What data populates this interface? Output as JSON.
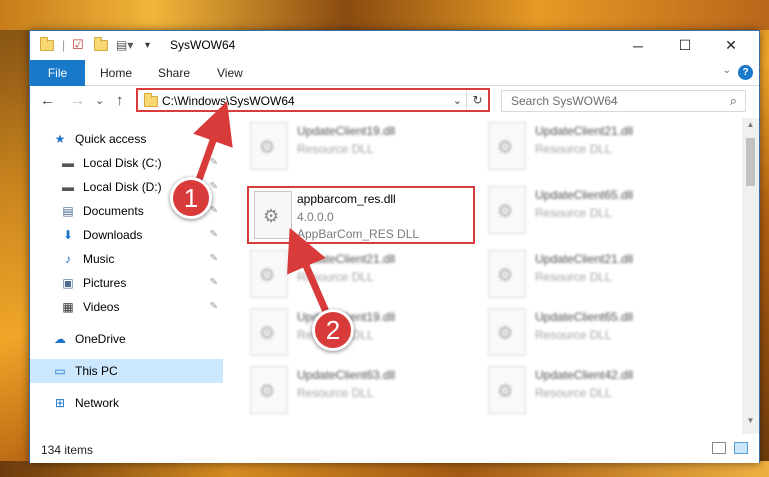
{
  "window": {
    "title": "SysWOW64",
    "minimize": "─",
    "maximize": "☐",
    "close": "✕"
  },
  "ribbon": {
    "tabs": [
      "File",
      "Home",
      "Share",
      "View"
    ],
    "help": "?",
    "collapse": "⌄"
  },
  "address": {
    "path": "C:\\Windows\\SysWOW64",
    "back": "←",
    "forward": "→",
    "recent": "⌄",
    "up": "↑",
    "dropdown": "⌄",
    "refresh": "↻"
  },
  "search": {
    "placeholder": "Search SysWOW64",
    "icon": "⌕"
  },
  "sidebar": {
    "items": [
      {
        "label": "Quick access",
        "icon": "star-icon",
        "glyph": "★",
        "color": "#1e74c8"
      },
      {
        "label": "Local Disk (C:)",
        "icon": "drive-icon",
        "glyph": "▬",
        "color": "#555555",
        "pinned": true
      },
      {
        "label": "Local Disk (D:)",
        "icon": "drive-icon",
        "glyph": "▬",
        "color": "#555555",
        "pinned": true
      },
      {
        "label": "Documents",
        "icon": "documents-icon",
        "glyph": "▤",
        "color": "#4d6a8f",
        "pinned": true
      },
      {
        "label": "Downloads",
        "icon": "download-icon",
        "glyph": "⬇",
        "color": "#1e74c8",
        "pinned": true
      },
      {
        "label": "Music",
        "icon": "music-icon",
        "glyph": "♪",
        "color": "#1e74c8",
        "pinned": true
      },
      {
        "label": "Pictures",
        "icon": "pictures-icon",
        "glyph": "▣",
        "color": "#4d6a8f",
        "pinned": true
      },
      {
        "label": "Videos",
        "icon": "videos-icon",
        "glyph": "▦",
        "color": "#333333",
        "pinned": true
      },
      {
        "label": "OneDrive",
        "icon": "cloud-icon",
        "glyph": "☁",
        "color": "#1e74c8"
      },
      {
        "label": "This PC",
        "icon": "computer-icon",
        "glyph": "▭",
        "color": "#1e74c8",
        "selected": true
      },
      {
        "label": "Network",
        "icon": "network-icon",
        "glyph": "⊞",
        "color": "#1e74c8"
      }
    ],
    "pin_glyph": "📌"
  },
  "files": {
    "highlighted": {
      "name": "appbarcom_res.dll",
      "version": "4.0.0.0",
      "description": "AppBarCom_RES DLL"
    },
    "blurred": [
      {
        "name": "UpdateClient19.dll",
        "type": "Resource DLL"
      },
      {
        "name": "UpdateClient21.dll",
        "type": "Resource DLL"
      },
      {
        "name": "UpdateClient65.dll",
        "type": "Resource DLL"
      },
      {
        "name": "UpdateClient21.dll",
        "type": "Resource DLL"
      },
      {
        "name": "UpdateClient21.dll",
        "type": "Resource DLL"
      },
      {
        "name": "UpdateClient19.dll",
        "type": "Resource DLL"
      },
      {
        "name": "UpdateClient65.dll",
        "type": "Resource DLL"
      },
      {
        "name": "UpdateClient63.dll",
        "type": "Resource DLL"
      },
      {
        "name": "UpdateClient42.dll",
        "type": "Resource DLL"
      }
    ]
  },
  "status": {
    "item_count": "134 items"
  },
  "annotations": {
    "step1": "1",
    "step2": "2",
    "color": "#d93a3a"
  }
}
